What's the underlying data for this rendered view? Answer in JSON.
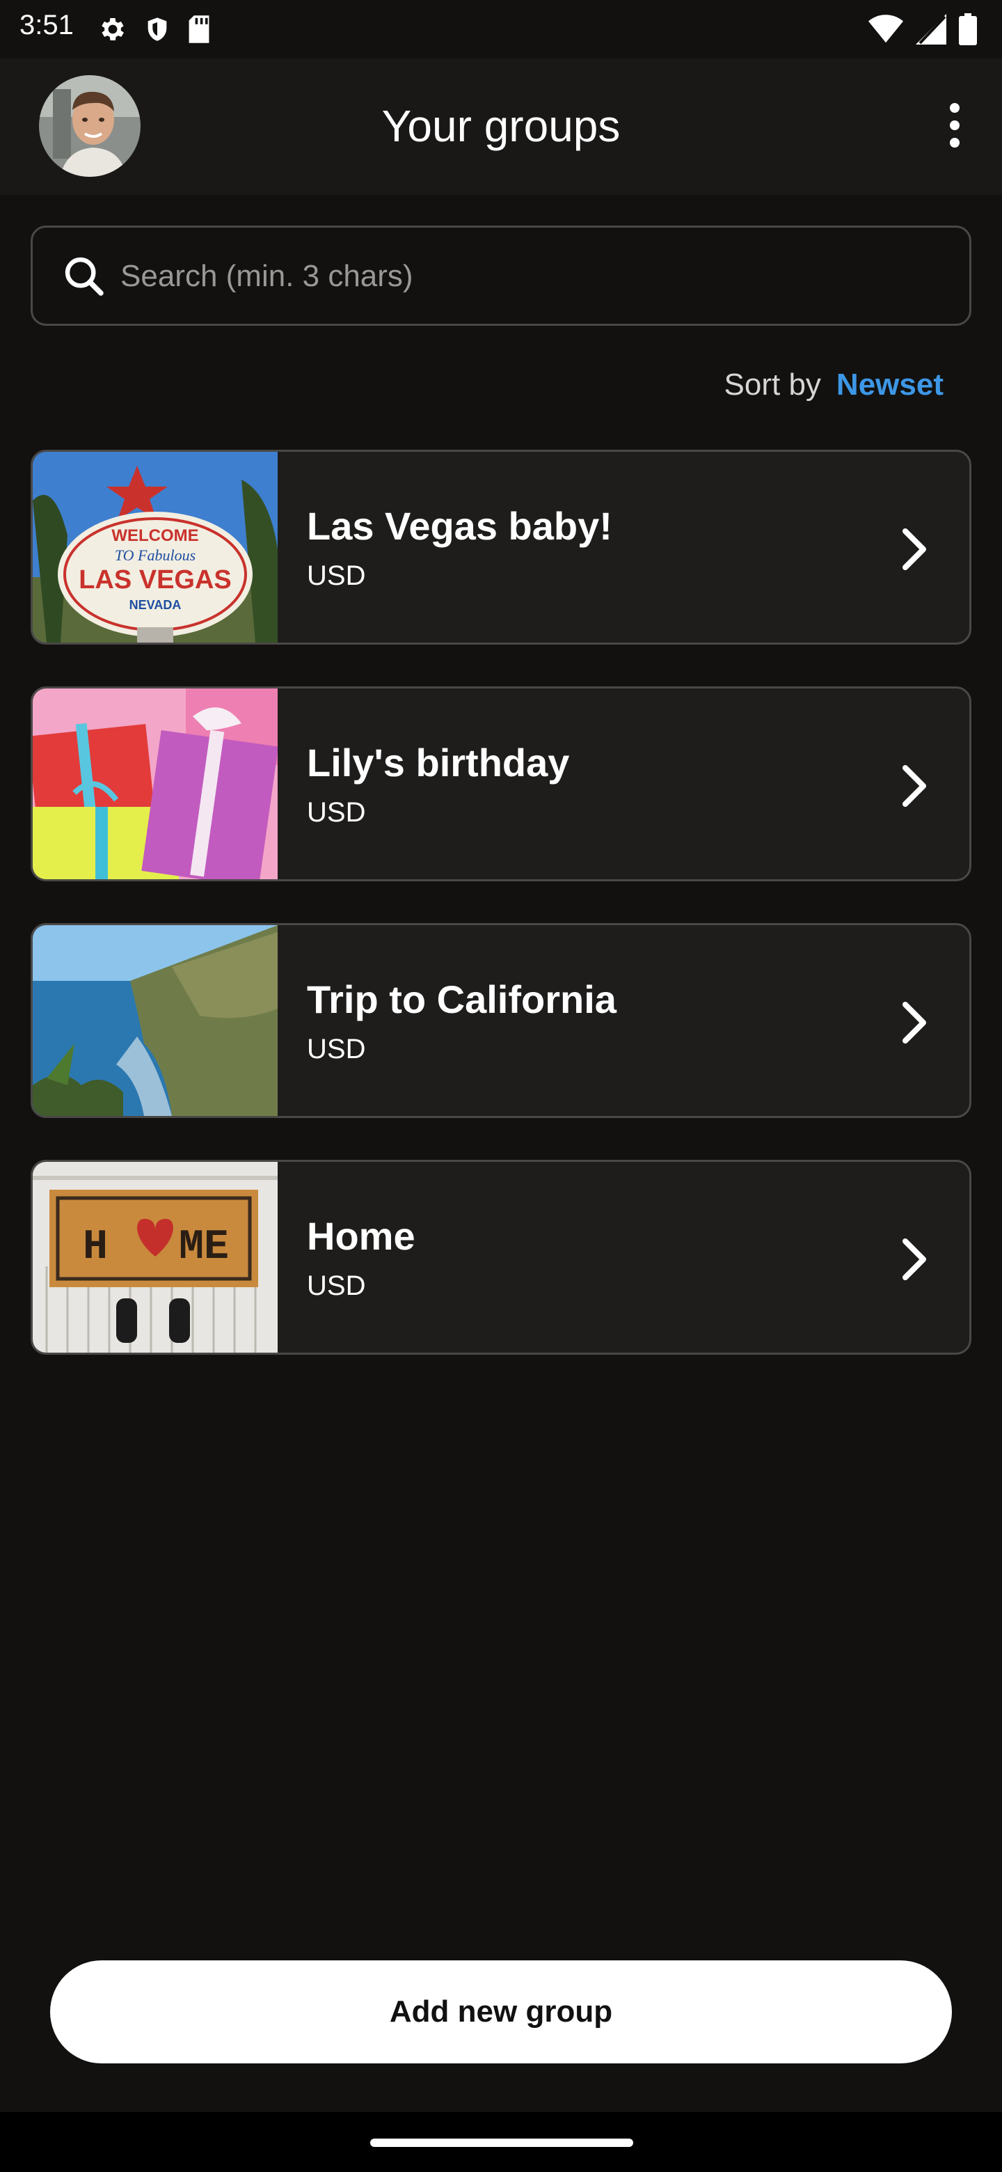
{
  "status_bar": {
    "time": "3:51",
    "left_icons": [
      "settings-icon",
      "shield-icon",
      "sd-card-icon"
    ],
    "right_icons": [
      "wifi-icon",
      "signal-icon",
      "battery-icon"
    ]
  },
  "header": {
    "title": "Your groups",
    "avatar": "avatar",
    "menu_icon": "more-vert-icon"
  },
  "search": {
    "placeholder": "Search (min. 3 chars)",
    "value": ""
  },
  "sort": {
    "label": "Sort by",
    "value": "Newset"
  },
  "groups": [
    {
      "title": "Las Vegas baby!",
      "currency": "USD",
      "thumbnail": "las-vegas-sign"
    },
    {
      "title": "Lily's birthday",
      "currency": "USD",
      "thumbnail": "gift-boxes"
    },
    {
      "title": "Trip to California",
      "currency": "USD",
      "thumbnail": "coastline"
    },
    {
      "title": "Home",
      "currency": "USD",
      "thumbnail": "home-doormat"
    }
  ],
  "actions": {
    "add_group": "Add new group"
  },
  "colors": {
    "background": "#121110",
    "header": "#191817",
    "card": "#1e1d1c",
    "border": "#4a4847",
    "accent": "#3d97e6"
  }
}
